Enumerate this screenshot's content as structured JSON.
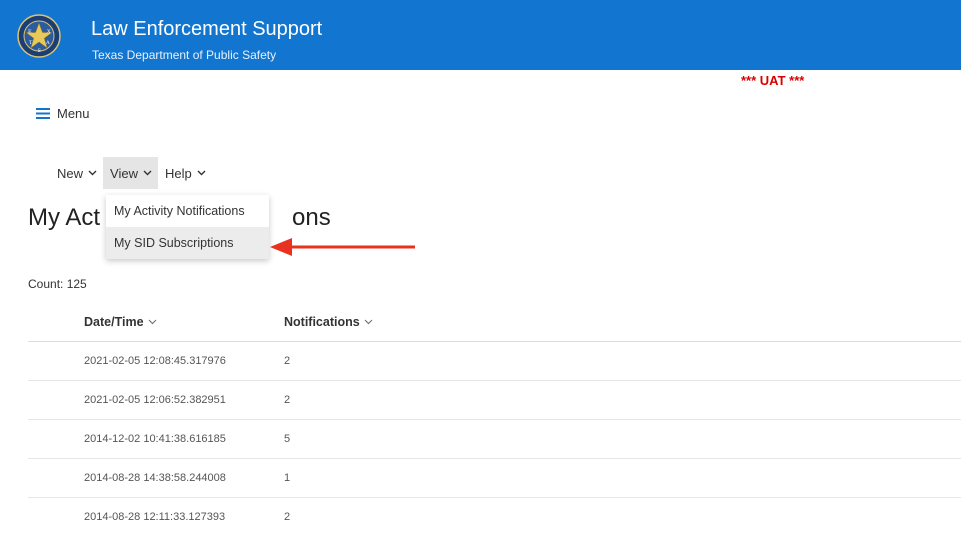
{
  "header": {
    "title": "Law Enforcement Support",
    "subtitle": "Texas Department of Public Safety",
    "seal_text": "DEPARTMENT OF PUBLIC SAFETY TEXAS",
    "seal_letters": [
      "T",
      "E",
      "X",
      "A",
      "S"
    ]
  },
  "environment_label": "*** UAT ***",
  "menu": {
    "label": "Menu",
    "icon": "hamburger-icon"
  },
  "menubar": {
    "items": [
      {
        "label": "New",
        "icon": "chevron-down-icon"
      },
      {
        "label": "View",
        "icon": "chevron-down-icon",
        "active": true
      },
      {
        "label": "Help",
        "icon": "chevron-down-icon"
      }
    ]
  },
  "dropdown": {
    "items": [
      {
        "label": "My Activity Notifications"
      },
      {
        "label": "My SID Subscriptions",
        "hovered": true
      }
    ]
  },
  "page": {
    "title_visible_start": "My Act",
    "title_visible_end": "ons",
    "count_text": "Count: 125"
  },
  "table": {
    "columns": [
      {
        "label": "Date/Time",
        "icon": "chevron-down-icon"
      },
      {
        "label": "Notifications",
        "icon": "chevron-down-icon"
      }
    ],
    "rows": [
      {
        "datetime": "2021-02-05 12:08:45.317976",
        "notifications": "2"
      },
      {
        "datetime": "2021-02-05 12:06:52.382951",
        "notifications": "2"
      },
      {
        "datetime": "2014-12-02 10:41:38.616185",
        "notifications": "5"
      },
      {
        "datetime": "2014-08-28 14:38:58.244008",
        "notifications": "1"
      },
      {
        "datetime": "2014-08-28 12:11:33.127393",
        "notifications": "2"
      }
    ]
  },
  "colors": {
    "header_bg": "#1275cf",
    "uat_red": "#d90000",
    "arrow_red": "#e8321f"
  }
}
